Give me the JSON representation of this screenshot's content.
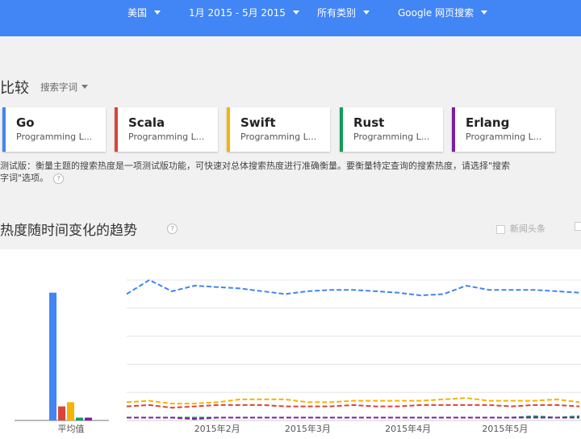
{
  "filters": {
    "region": "美国",
    "time_range": "1月 2015 - 5月 2015",
    "category": "所有类别",
    "search_type": "Google 网页搜索"
  },
  "compare": {
    "title": "比较",
    "mode": "搜索字词"
  },
  "terms": [
    {
      "name": "Go",
      "category": "Programming L...",
      "color": "#4285f4"
    },
    {
      "name": "Scala",
      "category": "Programming L...",
      "color": "#db4437"
    },
    {
      "name": "Swift",
      "category": "Programming L...",
      "color": "#f4b400"
    },
    {
      "name": "Rust",
      "category": "Programming L...",
      "color": "#0f9d58"
    },
    {
      "name": "Erlang",
      "category": "Programming L...",
      "color": "#7b1fa2"
    }
  ],
  "beta_note": "测试版：衡量主题的搜索热度是一项测试版功能，可快速对总体搜索热度进行准确衡量。要衡量特定查询的搜索热度，请选择\"搜索字词\"选项。",
  "help_icon": "?",
  "trend": {
    "title": "热度随时间变化的趋势",
    "news_checkbox_label": "新闻头条"
  },
  "chart_data": {
    "type": "line",
    "title": "",
    "ylim": [
      0,
      100
    ],
    "average_label": "平均值",
    "average": [
      {
        "term": "Go",
        "value": 91
      },
      {
        "term": "Scala",
        "value": 10
      },
      {
        "term": "Swift",
        "value": 13
      },
      {
        "term": "Rust",
        "value": 2
      },
      {
        "term": "Erlang",
        "value": 2
      }
    ],
    "x_ticks": [
      "2015年2月",
      "2015年3月",
      "2015年4月",
      "2015年5月"
    ],
    "x": [
      "2015-01-04",
      "2015-01-11",
      "2015-01-18",
      "2015-01-25",
      "2015-02-01",
      "2015-02-08",
      "2015-02-15",
      "2015-02-22",
      "2015-03-01",
      "2015-03-08",
      "2015-03-15",
      "2015-03-22",
      "2015-03-29",
      "2015-04-05",
      "2015-04-12",
      "2015-04-19",
      "2015-04-26",
      "2015-05-03",
      "2015-05-10",
      "2015-05-17",
      "2015-05-24"
    ],
    "series": [
      {
        "name": "Go",
        "color": "#4285f4",
        "values": [
          90,
          100,
          92,
          96,
          95,
          94,
          92,
          90,
          92,
          93,
          93,
          92,
          91,
          89,
          90,
          96,
          93,
          93,
          93,
          92,
          91
        ]
      },
      {
        "name": "Scala",
        "color": "#db4437",
        "values": [
          10,
          11,
          9,
          10,
          11,
          11,
          11,
          10,
          10,
          10,
          11,
          10,
          10,
          11,
          11,
          11,
          11,
          10,
          11,
          11,
          10
        ]
      },
      {
        "name": "Swift",
        "color": "#f4b400",
        "values": [
          13,
          14,
          12,
          12,
          13,
          15,
          15,
          15,
          13,
          13,
          14,
          14,
          14,
          14,
          15,
          16,
          14,
          14,
          14,
          15,
          13
        ]
      },
      {
        "name": "Rust",
        "color": "#0f9d58",
        "values": [
          2,
          2,
          2,
          2,
          2,
          2,
          2,
          2,
          2,
          2,
          2,
          2,
          2,
          2,
          2,
          2,
          2,
          2,
          3,
          2,
          3
        ]
      },
      {
        "name": "Erlang",
        "color": "#7b1fa2",
        "values": [
          2,
          2,
          2,
          1,
          2,
          2,
          2,
          2,
          2,
          2,
          2,
          2,
          2,
          2,
          2,
          2,
          2,
          2,
          2,
          2,
          2
        ]
      }
    ]
  }
}
